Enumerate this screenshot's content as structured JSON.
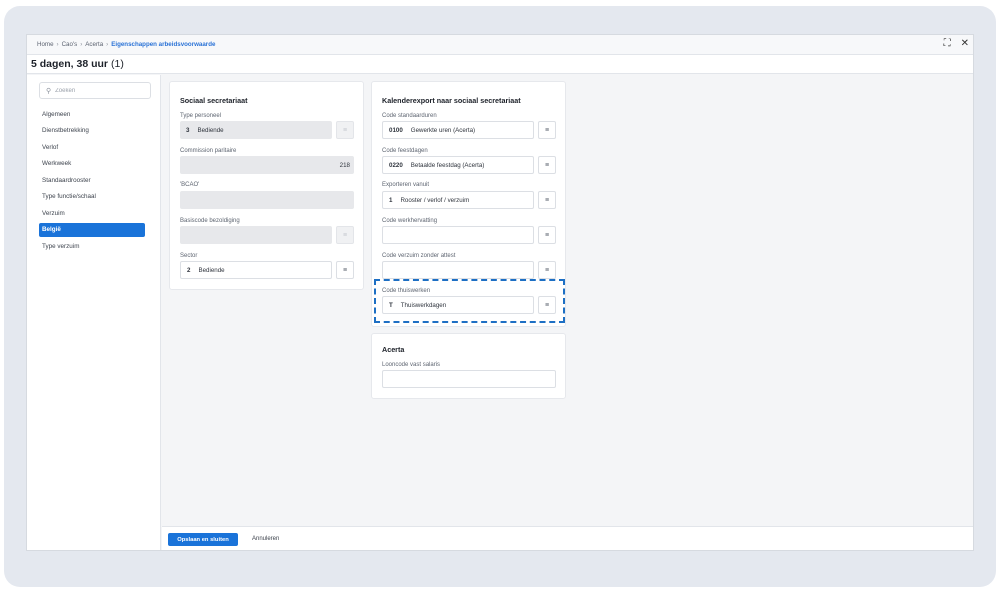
{
  "breadcrumb": {
    "items": [
      "Home",
      "Cao's",
      "Acerta"
    ],
    "current": "Eigenschappen arbeidsvoorwaarde"
  },
  "window_controls": {
    "expand_icon": "⛶",
    "close_icon": "✕"
  },
  "title": {
    "main": "5 dagen, 38 uur",
    "count": "(1)"
  },
  "sidebar": {
    "search_placeholder": "Zoeken",
    "items": [
      {
        "label": "Algemeen"
      },
      {
        "label": "Dienstbetrekking"
      },
      {
        "label": "Verlof"
      },
      {
        "label": "Werkweek"
      },
      {
        "label": "Standaardrooster"
      },
      {
        "label": "Type functie/schaal"
      },
      {
        "label": "Verzuim"
      },
      {
        "label": "België",
        "active": true
      },
      {
        "label": "Type verzuim"
      }
    ]
  },
  "sociaal": {
    "title": "Sociaal secretariaat",
    "type_personeel": {
      "label": "Type personeel",
      "code": "3",
      "value": "Bediende"
    },
    "commission": {
      "label": "Commission paritaire",
      "value": "218"
    },
    "bcao": {
      "label": "'BCAO'",
      "value": ""
    },
    "basiscode": {
      "label": "Basiscode bezoldiging",
      "value": ""
    },
    "sector": {
      "label": "Sector",
      "code": "2",
      "value": "Bediende"
    }
  },
  "kalender": {
    "title": "Kalenderexport naar sociaal secretariaat",
    "standaarduren": {
      "label": "Code standaarduren",
      "code": "0100",
      "value": "Gewerkte uren (Acerta)"
    },
    "feestdagen": {
      "label": "Code feestdagen",
      "code": "0220",
      "value": "Betaalde feestdag (Acerta)"
    },
    "exporteren": {
      "label": "Exporteren vanuit",
      "code": "1",
      "value": "Rooster / verlof / verzuim"
    },
    "werkhervatting": {
      "label": "Code werkhervatting",
      "value": ""
    },
    "verzuim_zonder_attest": {
      "label": "Code verzuim zonder attest",
      "value": ""
    },
    "thuiswerken": {
      "label": "Code thuiswerken",
      "code": "T",
      "value": "Thuiswerkdagen"
    }
  },
  "acerta": {
    "title": "Acerta",
    "looncode": {
      "label": "Looncode vast salaris",
      "value": ""
    }
  },
  "footer": {
    "save_label": "Opslaan en sluiten",
    "cancel_label": "Annuleren"
  },
  "colors": {
    "accent": "#1a73d9",
    "highlight_border": "#1d6fc4"
  },
  "icons": {
    "lookup": "list-lookup-icon",
    "search": "search-icon"
  }
}
